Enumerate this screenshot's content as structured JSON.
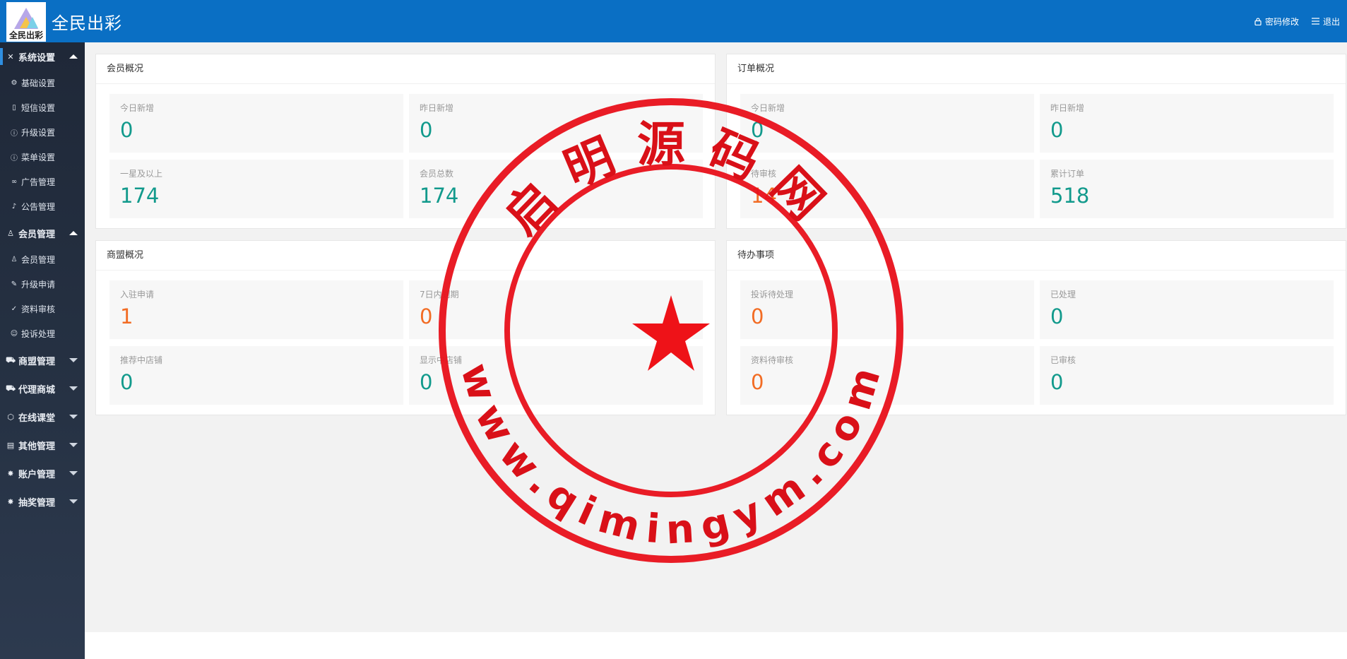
{
  "header": {
    "logo_text": "全民出彩",
    "app_title": "全民出彩",
    "password_link": "密码修改",
    "logout_link": "退出"
  },
  "sidebar": {
    "groups": [
      {
        "label": "系统设置",
        "icon": "tools-icon",
        "expanded": true,
        "items": [
          {
            "label": "基础设置",
            "icon": "gear-icon"
          },
          {
            "label": "短信设置",
            "icon": "phone-icon"
          },
          {
            "label": "升级设置",
            "icon": "info-circle-icon"
          },
          {
            "label": "菜单设置",
            "icon": "info-circle-icon"
          },
          {
            "label": "广告管理",
            "icon": "link-icon"
          },
          {
            "label": "公告管理",
            "icon": "bell-icon"
          }
        ]
      },
      {
        "label": "会员管理",
        "icon": "user-icon",
        "expanded": true,
        "items": [
          {
            "label": "会员管理",
            "icon": "user-icon"
          },
          {
            "label": "升级申请",
            "icon": "edit-icon"
          },
          {
            "label": "资料审核",
            "icon": "shield-check-icon"
          },
          {
            "label": "投诉处理",
            "icon": "smile-icon"
          }
        ]
      },
      {
        "label": "商盟管理",
        "icon": "cart-icon",
        "expanded": false
      },
      {
        "label": "代理商城",
        "icon": "cart-icon",
        "expanded": false
      },
      {
        "label": "在线课堂",
        "icon": "cube-icon",
        "expanded": false
      },
      {
        "label": "其他管理",
        "icon": "document-icon",
        "expanded": false
      },
      {
        "label": "账户管理",
        "icon": "gear-icon",
        "expanded": false
      },
      {
        "label": "抽奖管理",
        "icon": "gear-icon",
        "expanded": false
      }
    ]
  },
  "panels": {
    "members": {
      "title": "会员概况",
      "cards": [
        {
          "label": "今日新增",
          "value": "0"
        },
        {
          "label": "昨日新增",
          "value": "0"
        },
        {
          "label": "一星及以上",
          "value": "174"
        },
        {
          "label": "会员总数",
          "value": "174"
        }
      ]
    },
    "orders": {
      "title": "订单概况",
      "cards": [
        {
          "label": "今日新增",
          "value": "0"
        },
        {
          "label": "昨日新增",
          "value": "0"
        },
        {
          "label": "待审核",
          "value": "14"
        },
        {
          "label": "累计订单",
          "value": "518"
        }
      ]
    },
    "alliance": {
      "title": "商盟概况",
      "cards": [
        {
          "label": "入驻申请",
          "value": "1"
        },
        {
          "label": "7日内到期",
          "value": "0"
        },
        {
          "label": "推荐中店铺",
          "value": "0"
        },
        {
          "label": "显示中店铺",
          "value": "0"
        }
      ]
    },
    "todo": {
      "title": "待办事项",
      "cards": [
        {
          "label": "投诉待处理",
          "value": "0"
        },
        {
          "label": "已处理",
          "value": "0"
        },
        {
          "label": "资料待审核",
          "value": "0"
        },
        {
          "label": "已审核",
          "value": "0"
        }
      ]
    }
  },
  "watermark": {
    "top_text": "启明源码网",
    "bottom_text": "www.qimingym.com"
  },
  "colors": {
    "header_bg": "#0a6fc4",
    "teal_value": "#129a8c",
    "orange_value": "#f26c24",
    "stamp_red": "#e8101a"
  }
}
